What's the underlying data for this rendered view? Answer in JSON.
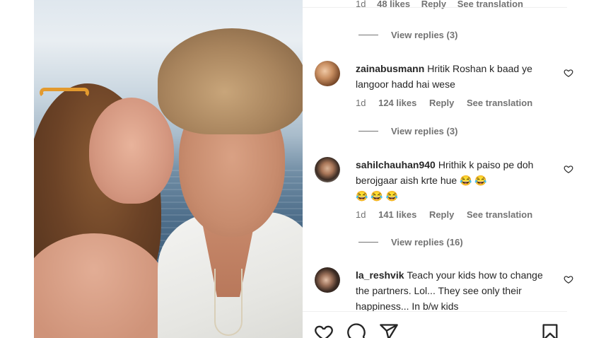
{
  "colors": {
    "text_primary": "#262626",
    "text_secondary": "#737373",
    "divider": "#efefef",
    "laugh_emoji": "#f7c531"
  },
  "top_partial": {
    "time": "1d",
    "likes": "48 likes",
    "reply": "Reply",
    "translation": "See translation"
  },
  "comments": [
    {
      "replies_label": "View replies (3)",
      "username": "zainabusmann",
      "text": "Hritik Roshan k baad ye langoor hadd hai wese",
      "time": "1d",
      "likes": "124 likes",
      "reply": "Reply",
      "translation": "See translation",
      "icons": {
        "like": "heart-outline-icon"
      }
    },
    {
      "replies_label": "View replies (3)",
      "username": "sahilchauhan940",
      "text": "Hrithik k paiso pe doh berojgaar aish krte hue",
      "emojis_line1": "😂 😂",
      "emojis_line2": "😂 😂 😂",
      "time": "1d",
      "likes": "141 likes",
      "reply": "Reply",
      "translation": "See translation",
      "icons": {
        "like": "heart-outline-icon"
      }
    },
    {
      "replies_label": "View replies (16)",
      "username": "la_reshvik",
      "text": "Teach your kids how to change the partners. Lol... They see only their happiness... In b/w kids",
      "icons": {
        "like": "heart-outline-icon"
      }
    }
  ],
  "actions": {
    "like_icon": "heart-outline-icon",
    "comment_icon": "comment-bubble-icon",
    "share_icon": "paper-plane-icon",
    "save_icon": "bookmark-icon"
  }
}
